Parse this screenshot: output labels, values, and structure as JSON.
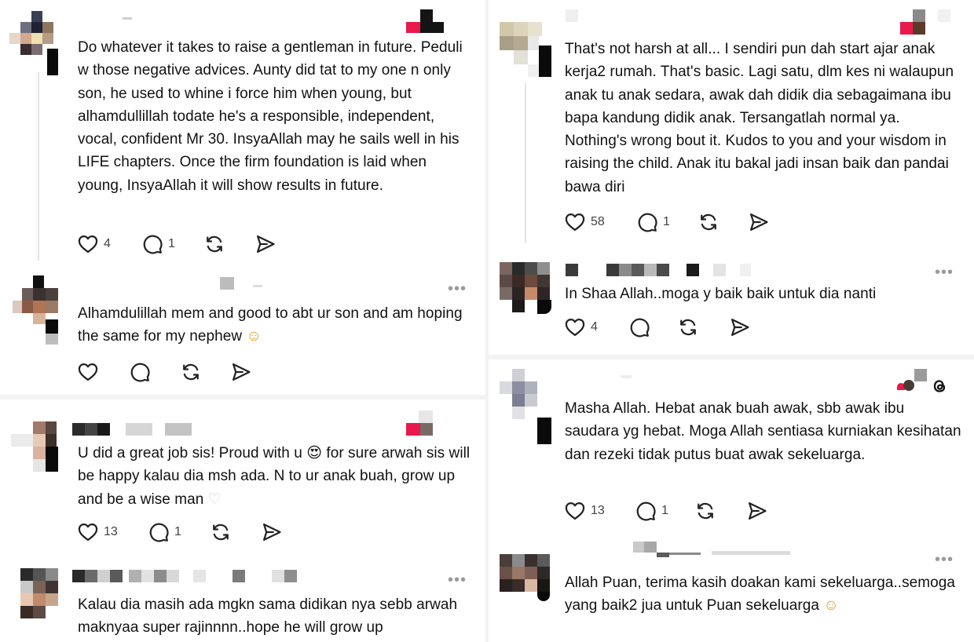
{
  "left": {
    "comments": [
      {
        "text": "Do whatever it takes to raise a gentleman in future. Peduli w those negative advices. Aunty did tat to my one n only son, he used to whine i force him when young, but alhamdullillah todate he's a responsible, independent, vocal, confident Mr 30. InsyaAllah may he sails well in his LIFE chapters. Once the firm foundation is laid when young, InsyaAllah it will show results in future.",
        "likes": "4",
        "replies": "1"
      },
      {
        "text": "Alhamdulillah mem and good to abt ur son and am hoping the same for my nephew",
        "emoji": "☺",
        "more": "•••"
      },
      {
        "text_a": "U did a great job sis! Proud with u",
        "emoji_a": "😍",
        "text_b": "for sure arwah sis will be happy kalau dia msh ada. N to ur anak buah, grow up and be a wise man",
        "emoji_b": "♡",
        "likes": "13",
        "replies": "1"
      },
      {
        "text": "Kalau dia masih ada mgkn sama didikan nya sebb arwah maknyaa super rajinnnn..hope he will grow up",
        "more": "•••"
      }
    ]
  },
  "right": {
    "comments": [
      {
        "text": "That's not harsh at all... I sendiri pun dah start ajar anak kerja2 rumah. That's basic. Lagi satu, dlm kes ni walaupun anak tu anak sedara, awak dah didik dia sebagaimana ibu bapa kandung didik anak. Tersangatlah normal ya. Nothing's wrong bout it. Kudos to you and your wisdom in raising the child. Anak itu bakal jadi insan baik dan pandai bawa diri",
        "likes": "58",
        "replies": "1"
      },
      {
        "text": "In Shaa Allah..moga y baik baik untuk dia nanti",
        "likes": "4",
        "more": "•••"
      },
      {
        "text": "Masha Allah. Hebat anak buah awak, sbb awak ibu saudara yg hebat. Moga Allah sentiasa kurniakan kesihatan dan rezeki tidak putus buat awak sekeluarga.",
        "likes": "13",
        "replies": "1"
      },
      {
        "text": "Allah Puan, terima kasih doakan kami sekeluarga..semoga yang baik2 jua untuk Puan sekeluarga",
        "emoji": "☺",
        "more": "•••"
      }
    ]
  },
  "colors": {
    "heart_red": "#e8194b",
    "text": "#111111",
    "muted": "#9a9a9a"
  },
  "icons": [
    "heart-icon",
    "comment-icon",
    "repost-icon",
    "share-icon",
    "more-icon",
    "threads-logo-icon"
  ]
}
